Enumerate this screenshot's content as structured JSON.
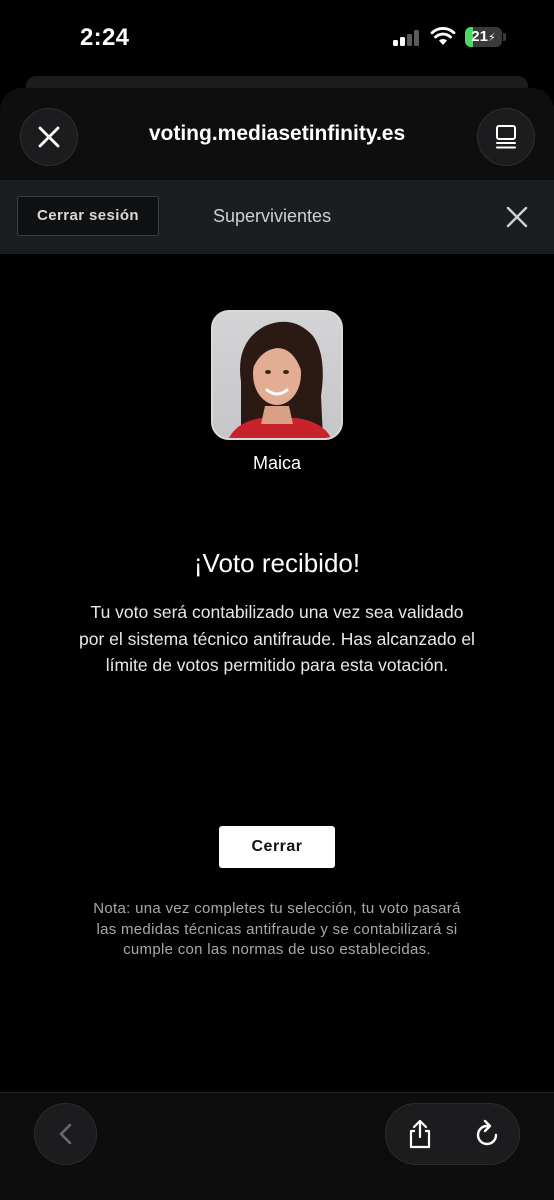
{
  "status_bar": {
    "time": "2:24",
    "battery_level": "21",
    "battery_fraction": 0.21,
    "battery_color": "#4cd964",
    "icons": [
      "cellular-signal-icon",
      "wifi-icon",
      "charging-bolt-icon"
    ]
  },
  "browser": {
    "url": "voting.mediasetinfinity.es",
    "close_icon": "close-icon",
    "tabs_icon": "tabs-icon"
  },
  "site_nav": {
    "logout_label": "Cerrar sesión",
    "title": "Supervivientes",
    "close_icon": "close-icon"
  },
  "contestant": {
    "name": "Maica"
  },
  "confirmation": {
    "title": "¡Voto recibido!",
    "message": "Tu voto será contabilizado una vez sea validado por el sistema técnico antifraude. Has alcanzado el límite de votos permitido para esta votación.",
    "close_label": "Cerrar",
    "note": "Nota: una vez completes tu selección, tu voto pasará las medidas técnicas antifraude y se contabilizará si cumple con las normas de uso establecidas."
  },
  "toolbar": {
    "icons": [
      "back-chevron-icon",
      "share-icon",
      "reload-icon"
    ]
  },
  "colors": {
    "background": "#000000",
    "site_bar": "#1b1e21",
    "button_light": "#ffffff"
  }
}
